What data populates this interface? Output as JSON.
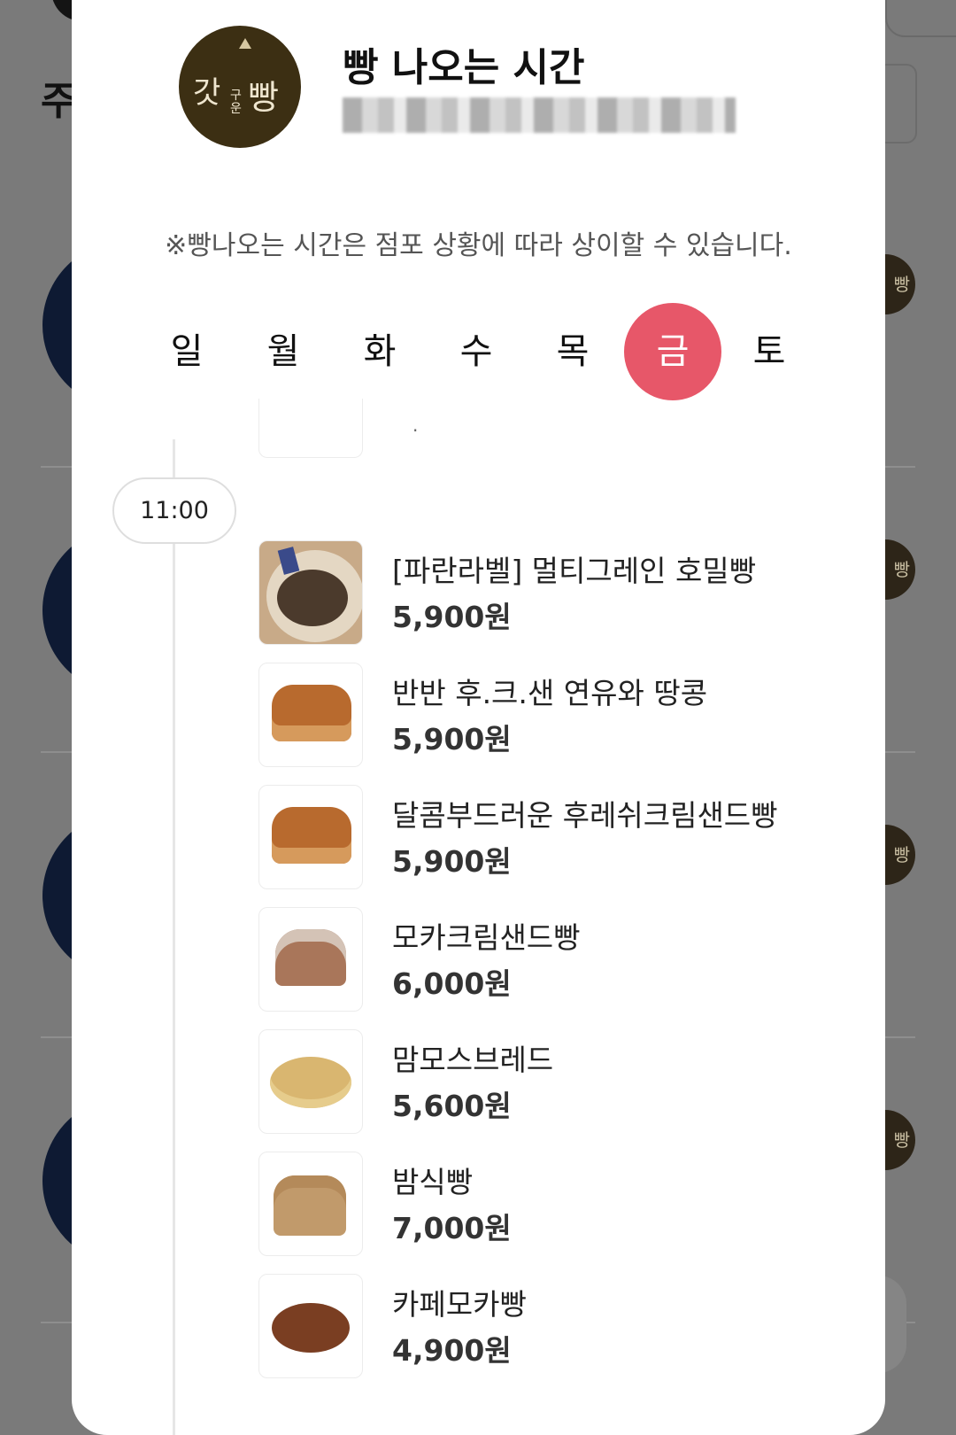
{
  "background": {
    "title": "주"
  },
  "modal": {
    "store_logo_text": "갓구운빵",
    "title": "빵 나오는 시간",
    "notice": "※빵나오는 시간은 점포 상황에 따라 상이할 수 있습니다.",
    "days": [
      "일",
      "월",
      "화",
      "수",
      "목",
      "금",
      "토"
    ],
    "selected_day": "금",
    "time_slot": "11:00",
    "items": [
      {
        "name": "[파란라벨] 멀티그레인 호밀빵",
        "price": "5,900원"
      },
      {
        "name": "반반 후.크.샌 연유와 땅콩",
        "price": "5,900원"
      },
      {
        "name": "달콤부드러운 후레쉬크림샌드빵",
        "price": "5,900원"
      },
      {
        "name": "모카크림샌드빵",
        "price": "6,000원"
      },
      {
        "name": "맘모스브레드",
        "price": "5,600원"
      },
      {
        "name": "밤식빵",
        "price": "7,000원"
      },
      {
        "name": "카페모카빵",
        "price": "4,900원"
      }
    ]
  },
  "colors": {
    "accent": "#e75769",
    "overlay": "#7a7a7a",
    "logo_bg": "#3c2f13"
  }
}
